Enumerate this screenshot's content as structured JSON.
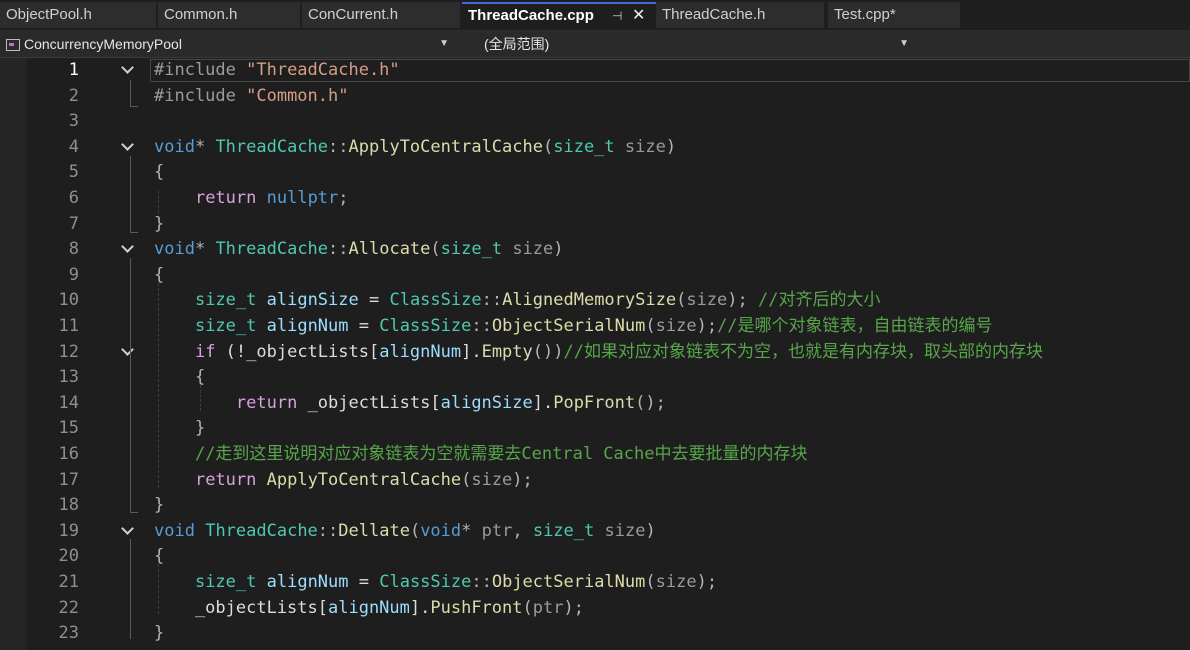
{
  "tabs": [
    {
      "label": "ObjectPool.h",
      "active": false
    },
    {
      "label": "Common.h",
      "active": false
    },
    {
      "label": "ConCurrent.h",
      "active": false
    },
    {
      "label": "ThreadCache.cpp",
      "active": true
    },
    {
      "label": "ThreadCache.h",
      "active": false
    },
    {
      "label": "Test.cpp*",
      "active": false
    }
  ],
  "navbar": {
    "project": "ConcurrencyMemoryPool",
    "scope": "(全局范围)"
  },
  "editor": {
    "current_line": 1,
    "lines": [
      {
        "n": "1",
        "fold": true,
        "tokens": [
          [
            "pre",
            "#include "
          ],
          [
            "str",
            "\"ThreadCache.h\""
          ]
        ]
      },
      {
        "n": "2",
        "fold": false,
        "tokens": [
          [
            "pre",
            "#include "
          ],
          [
            "str",
            "\"Common.h\""
          ]
        ]
      },
      {
        "n": "3",
        "fold": false,
        "tokens": []
      },
      {
        "n": "4",
        "fold": true,
        "tokens": [
          [
            "kw",
            "void"
          ],
          [
            "punct",
            "* "
          ],
          [
            "type",
            "ThreadCache"
          ],
          [
            "punct",
            "::"
          ],
          [
            "fn",
            "ApplyToCentralCache"
          ],
          [
            "punct",
            "("
          ],
          [
            "type",
            "size_t"
          ],
          [
            "param",
            " size"
          ],
          [
            "punct",
            ")"
          ]
        ]
      },
      {
        "n": "5",
        "fold": false,
        "tokens": [
          [
            "punct",
            "{"
          ]
        ]
      },
      {
        "n": "6",
        "fold": false,
        "tokens": [
          [
            "txt",
            "    "
          ],
          [
            "ctl",
            "return"
          ],
          [
            "txt",
            " "
          ],
          [
            "kw",
            "nullptr"
          ],
          [
            "punct",
            ";"
          ]
        ]
      },
      {
        "n": "7",
        "fold": false,
        "tokens": [
          [
            "punct",
            "}"
          ]
        ]
      },
      {
        "n": "8",
        "fold": true,
        "tokens": [
          [
            "kw",
            "void"
          ],
          [
            "punct",
            "* "
          ],
          [
            "type",
            "ThreadCache"
          ],
          [
            "punct",
            "::"
          ],
          [
            "fn",
            "Allocate"
          ],
          [
            "punct",
            "("
          ],
          [
            "type",
            "size_t"
          ],
          [
            "param",
            " size"
          ],
          [
            "punct",
            ")"
          ]
        ]
      },
      {
        "n": "9",
        "fold": false,
        "tokens": [
          [
            "punct",
            "{"
          ]
        ]
      },
      {
        "n": "10",
        "fold": false,
        "tokens": [
          [
            "txt",
            "    "
          ],
          [
            "type",
            "size_t"
          ],
          [
            "txt",
            " "
          ],
          [
            "var",
            "alignSize"
          ],
          [
            "txt",
            " = "
          ],
          [
            "type",
            "ClassSize"
          ],
          [
            "punct",
            "::"
          ],
          [
            "fn",
            "AlignedMemorySize"
          ],
          [
            "punct",
            "("
          ],
          [
            "param",
            "size"
          ],
          [
            "punct",
            ");"
          ],
          [
            "txt",
            " "
          ],
          [
            "cmt",
            "//对齐后的大小"
          ]
        ]
      },
      {
        "n": "11",
        "fold": false,
        "tokens": [
          [
            "txt",
            "    "
          ],
          [
            "type",
            "size_t"
          ],
          [
            "txt",
            " "
          ],
          [
            "var",
            "alignNum"
          ],
          [
            "txt",
            " = "
          ],
          [
            "type",
            "ClassSize"
          ],
          [
            "punct",
            "::"
          ],
          [
            "fn",
            "ObjectSerialNum"
          ],
          [
            "punct",
            "("
          ],
          [
            "param",
            "size"
          ],
          [
            "punct",
            ");"
          ],
          [
            "cmt",
            "//是哪个对象链表，自由链表的编号"
          ]
        ]
      },
      {
        "n": "12",
        "fold": true,
        "tokens": [
          [
            "txt",
            "    "
          ],
          [
            "ctl",
            "if"
          ],
          [
            "txt",
            " (!_objectLists["
          ],
          [
            "var",
            "alignNum"
          ],
          [
            "txt",
            "]."
          ],
          [
            "fn",
            "Empty"
          ],
          [
            "punct",
            "())"
          ],
          [
            "cmt",
            "//如果对应对象链表不为空，也就是有内存块，取头部的内存块"
          ]
        ]
      },
      {
        "n": "13",
        "fold": false,
        "tokens": [
          [
            "txt",
            "    "
          ],
          [
            "punct",
            "{"
          ]
        ]
      },
      {
        "n": "14",
        "fold": false,
        "tokens": [
          [
            "txt",
            "        "
          ],
          [
            "ctl",
            "return"
          ],
          [
            "txt",
            " _objectLists["
          ],
          [
            "var",
            "alignSize"
          ],
          [
            "txt",
            "]."
          ],
          [
            "fn",
            "PopFront"
          ],
          [
            "punct",
            "();"
          ]
        ]
      },
      {
        "n": "15",
        "fold": false,
        "tokens": [
          [
            "txt",
            "    "
          ],
          [
            "punct",
            "}"
          ]
        ]
      },
      {
        "n": "16",
        "fold": false,
        "tokens": [
          [
            "txt",
            "    "
          ],
          [
            "cmt",
            "//走到这里说明对应对象链表为空就需要去Central Cache中去要批量的内存块"
          ]
        ]
      },
      {
        "n": "17",
        "fold": false,
        "tokens": [
          [
            "txt",
            "    "
          ],
          [
            "ctl",
            "return"
          ],
          [
            "txt",
            " "
          ],
          [
            "fn",
            "ApplyToCentralCache"
          ],
          [
            "punct",
            "("
          ],
          [
            "param",
            "size"
          ],
          [
            "punct",
            ");"
          ]
        ]
      },
      {
        "n": "18",
        "fold": false,
        "tokens": [
          [
            "punct",
            "}"
          ]
        ]
      },
      {
        "n": "19",
        "fold": true,
        "tokens": [
          [
            "kw",
            "void"
          ],
          [
            "txt",
            " "
          ],
          [
            "type",
            "ThreadCache"
          ],
          [
            "punct",
            "::"
          ],
          [
            "fn",
            "Dellate"
          ],
          [
            "punct",
            "("
          ],
          [
            "kw",
            "void"
          ],
          [
            "punct",
            "*"
          ],
          [
            "param",
            " ptr"
          ],
          [
            "punct",
            ", "
          ],
          [
            "type",
            "size_t"
          ],
          [
            "param",
            " size"
          ],
          [
            "punct",
            ")"
          ]
        ]
      },
      {
        "n": "20",
        "fold": false,
        "tokens": [
          [
            "punct",
            "{"
          ]
        ]
      },
      {
        "n": "21",
        "fold": false,
        "tokens": [
          [
            "txt",
            "    "
          ],
          [
            "type",
            "size_t"
          ],
          [
            "txt",
            " "
          ],
          [
            "var",
            "alignNum"
          ],
          [
            "txt",
            " = "
          ],
          [
            "type",
            "ClassSize"
          ],
          [
            "punct",
            "::"
          ],
          [
            "fn",
            "ObjectSerialNum"
          ],
          [
            "punct",
            "("
          ],
          [
            "param",
            "size"
          ],
          [
            "punct",
            ");"
          ]
        ]
      },
      {
        "n": "22",
        "fold": false,
        "tokens": [
          [
            "txt",
            "    _objectLists["
          ],
          [
            "var",
            "alignNum"
          ],
          [
            "txt",
            "]."
          ],
          [
            "fn",
            "PushFront"
          ],
          [
            "punct",
            "("
          ],
          [
            "param",
            "ptr"
          ],
          [
            "punct",
            ");"
          ]
        ]
      },
      {
        "n": "23",
        "fold": false,
        "tokens": [
          [
            "punct",
            "}"
          ]
        ]
      }
    ]
  }
}
